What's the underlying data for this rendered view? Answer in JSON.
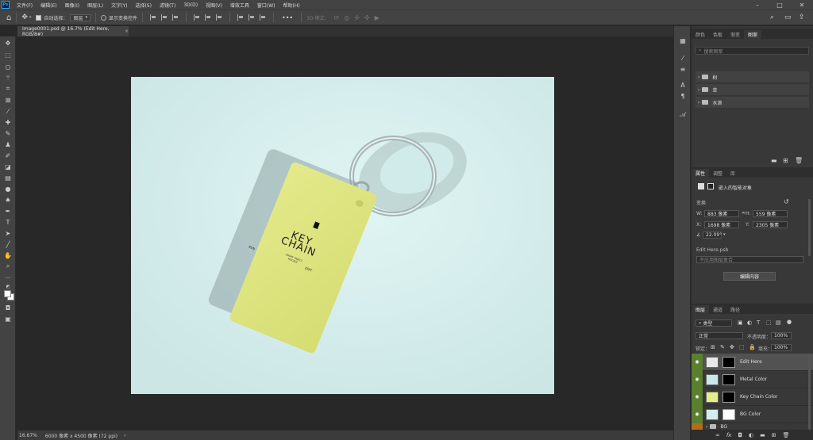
{
  "app": {
    "logo": "Ps"
  },
  "menu": [
    "文件(F)",
    "编辑(E)",
    "图像(I)",
    "图层(L)",
    "文字(Y)",
    "选择(S)",
    "滤镜(T)",
    "3D(D)",
    "视图(V)",
    "增效工具",
    "窗口(W)",
    "帮助(H)"
  ],
  "options": {
    "auto_select_label": "自动选择：",
    "auto_select_value": "图层",
    "show_transform_label": "显示变换控件",
    "mode_3d_label": "3D 模式："
  },
  "document_tab": {
    "title": "Image0001.psd @ 16.7% (Edit Here, RGB/8#)",
    "close": "×"
  },
  "status": {
    "zoom": "16.67%",
    "info": "6000 像素 x 4500 像素 (72 ppi)",
    "arrow": "›"
  },
  "top_panel": {
    "tabs": [
      "颜色",
      "色板",
      "渐变",
      "图案"
    ],
    "active_tab": "图案",
    "search_placeholder": "搜索图案",
    "folders": [
      "树",
      "草",
      "水滴"
    ]
  },
  "properties_panel": {
    "tabs": [
      "属性",
      "调整",
      "库"
    ],
    "active_tab": "属性",
    "object_type": "嵌入的智能对象",
    "transform_label": "变换",
    "w_label": "W:",
    "w_value": "883 像素",
    "h_label": "H:",
    "h_value": "559 像素",
    "x_label": "X:",
    "x_value": "1698 像素",
    "y_label": "Y:",
    "y_value": "2305 像素",
    "angle_value": "22.09°",
    "file_name": "Edit Here.psb",
    "comp_placeholder": "不应用图层复合",
    "edit_button": "编辑内容"
  },
  "layers_panel": {
    "tabs": [
      "图层",
      "通道",
      "路径"
    ],
    "active_tab": "图层",
    "filter_label": "类型",
    "blend_mode": "正常",
    "opacity_label": "不透明度：",
    "opacity_value": "100%",
    "lock_label": "锁定：",
    "fill_label": "填充：",
    "fill_value": "100%",
    "layers": [
      {
        "name": "Edit Here",
        "selected": true,
        "thumb": "#e8e8e8"
      },
      {
        "name": "Metal Color",
        "selected": false,
        "thumb": "#c8e8ec"
      },
      {
        "name": "Key Chain Color",
        "selected": false,
        "thumb": "#e6ee8a"
      },
      {
        "name": "BG Color",
        "selected": false,
        "thumb": "#d3edec"
      }
    ],
    "group_name": "BG",
    "bottom_icons": [
      "fx"
    ]
  },
  "artwork": {
    "tag_left": "RVN",
    "tag_title_1": "KEY",
    "tag_title_2": "CHAIN",
    "tag_right": "EDIT",
    "tag_small_1": "SMART OBJECT",
    "tag_small_2": "MOCKUP",
    "bg_color": "#d3edec",
    "tag_color": "#dfe57e"
  }
}
